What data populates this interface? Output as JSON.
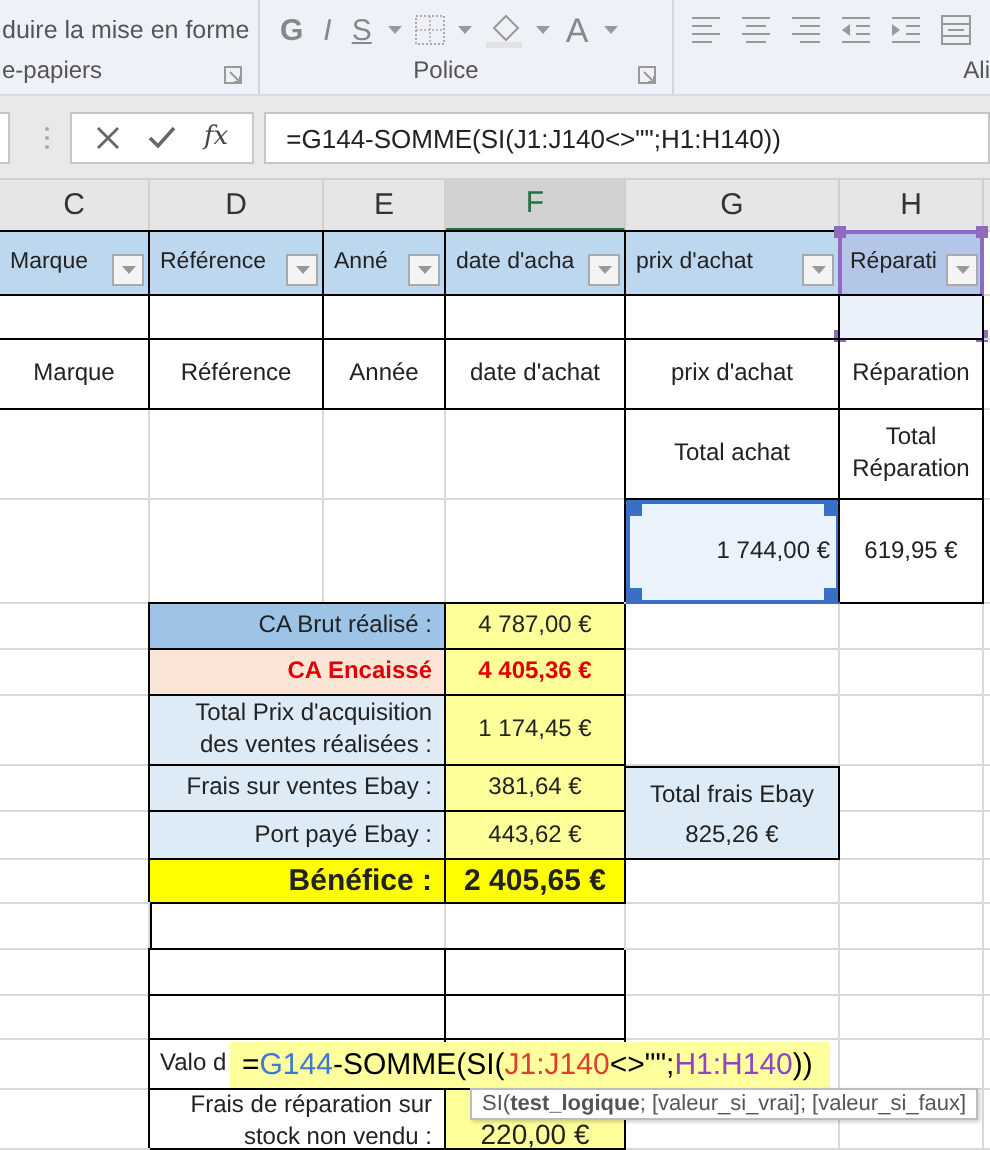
{
  "ribbon": {
    "clipboard_text": "duire la mise en forme",
    "groups": [
      "e-papiers",
      "Police",
      "Ali"
    ],
    "font_buttons": [
      "G",
      "I",
      "S"
    ],
    "font_color_letter": "A"
  },
  "formula_bar": {
    "function_label": "fx",
    "formula": "=G144-SOMME(SI(J1:J140<>\"\";H1:H140))"
  },
  "columns": [
    {
      "label": "C",
      "selected": false
    },
    {
      "label": "D",
      "selected": false
    },
    {
      "label": "E",
      "selected": false
    },
    {
      "label": "F",
      "selected": true
    },
    {
      "label": "G",
      "selected": false
    },
    {
      "label": "H",
      "selected": false
    }
  ],
  "table_headers": [
    {
      "text": "Marque",
      "selected": false
    },
    {
      "text": "Référence",
      "selected": false
    },
    {
      "text": "Anné",
      "selected": false
    },
    {
      "text": "date d'acha",
      "selected": false
    },
    {
      "text": "prix d'achat",
      "selected": false
    },
    {
      "text": "Réparati",
      "selected": true
    }
  ],
  "labels_row": [
    "Marque",
    "Référence",
    "Année",
    "date d'achat",
    "prix d'achat",
    "Réparation"
  ],
  "totals": [
    {
      "label": "Total achat",
      "value": "1 744,00 €",
      "selected": true
    },
    {
      "label": "Total Réparation",
      "value": "619,95 €",
      "selected": false
    }
  ],
  "summary": [
    {
      "kind": "gross",
      "label": "CA Brut réalisé :",
      "value": "4 787,00 €"
    },
    {
      "kind": "cashed",
      "label": "CA Encaissé",
      "value": "4 405,36 €"
    },
    {
      "kind": "normal",
      "label": "Total Prix d'acquisition des ventes réalisées :",
      "value": "1 174,45 €"
    },
    {
      "kind": "fees",
      "label": "Frais sur ventes Ebay :",
      "value": "381,64 €"
    },
    {
      "kind": "fees",
      "label": "Port payé Ebay :",
      "value": "443,62 €"
    },
    {
      "kind": "profit",
      "label": "Bénéfice :",
      "value": "2 405,65 €"
    }
  ],
  "ebay_total": {
    "label": "Total frais Ebay",
    "value": "825,26 €"
  },
  "valo_label": "Valo d",
  "edit_formula": [
    {
      "text": "=",
      "color": "#000000"
    },
    {
      "text": "G144",
      "color": "#3c78d8"
    },
    {
      "text": "-SOMME(SI(",
      "color": "#000000"
    },
    {
      "text": "J1:J140",
      "color": "#e03c31"
    },
    {
      "text": "<>\"\";",
      "color": "#000000"
    },
    {
      "text": "H1:H140",
      "color": "#8e44c6"
    },
    {
      "text": "))",
      "color": "#000000"
    }
  ],
  "tooltip": "SI(**test_logique**; [valeur_si_vrai]; [valeur_si_faux]",
  "repair_stock": {
    "label": "Frais de réparation sur stock non vendu :",
    "value": "220,00 €"
  }
}
